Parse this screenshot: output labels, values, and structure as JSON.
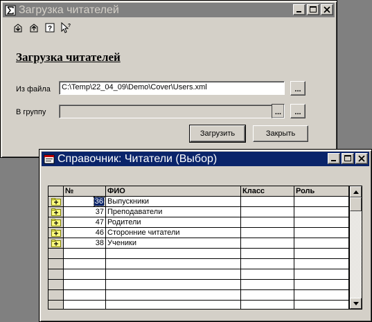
{
  "upload_window": {
    "title": "Загрузка читателей",
    "toolbar_icons": [
      "import-icon",
      "export-icon",
      "help-icon",
      "pointer-help-icon"
    ],
    "heading": "Загрузка читателей",
    "file_label": "Из файла",
    "file_value": "C:\\Temp\\22_04_09\\Demo\\Cover\\Users.xml",
    "browse_label": "...",
    "group_label": "В группу",
    "group_value": "",
    "group_select_label": "...",
    "group_browse_label": "...",
    "load_button": "Загрузить",
    "close_button": "Закрыть"
  },
  "directory_window": {
    "title": "Справочник: Читатели (Выбор)",
    "columns": [
      "№",
      "ФИО",
      "Класс",
      "Роль"
    ],
    "rows": [
      {
        "num": "36",
        "name": "Выпускники",
        "class": "",
        "role": "",
        "icon": "folder-plus-icon"
      },
      {
        "num": "37",
        "name": "Преподаватели",
        "class": "",
        "role": "",
        "icon": "folder-plus-icon"
      },
      {
        "num": "47",
        "name": "Родители",
        "class": "",
        "role": "",
        "icon": "folder-plus-icon"
      },
      {
        "num": "46",
        "name": "Сторонние читатели",
        "class": "",
        "role": "",
        "icon": "folder-plus-icon"
      },
      {
        "num": "38",
        "name": "Ученики",
        "class": "",
        "role": "",
        "icon": "folder-plus-icon"
      }
    ],
    "selected_row": 0,
    "empty_rows": 6
  },
  "colors": {
    "desktop": "#808080",
    "face": "#d4d0c8",
    "active_title": "#0a246a",
    "inactive_title": "#808080"
  }
}
